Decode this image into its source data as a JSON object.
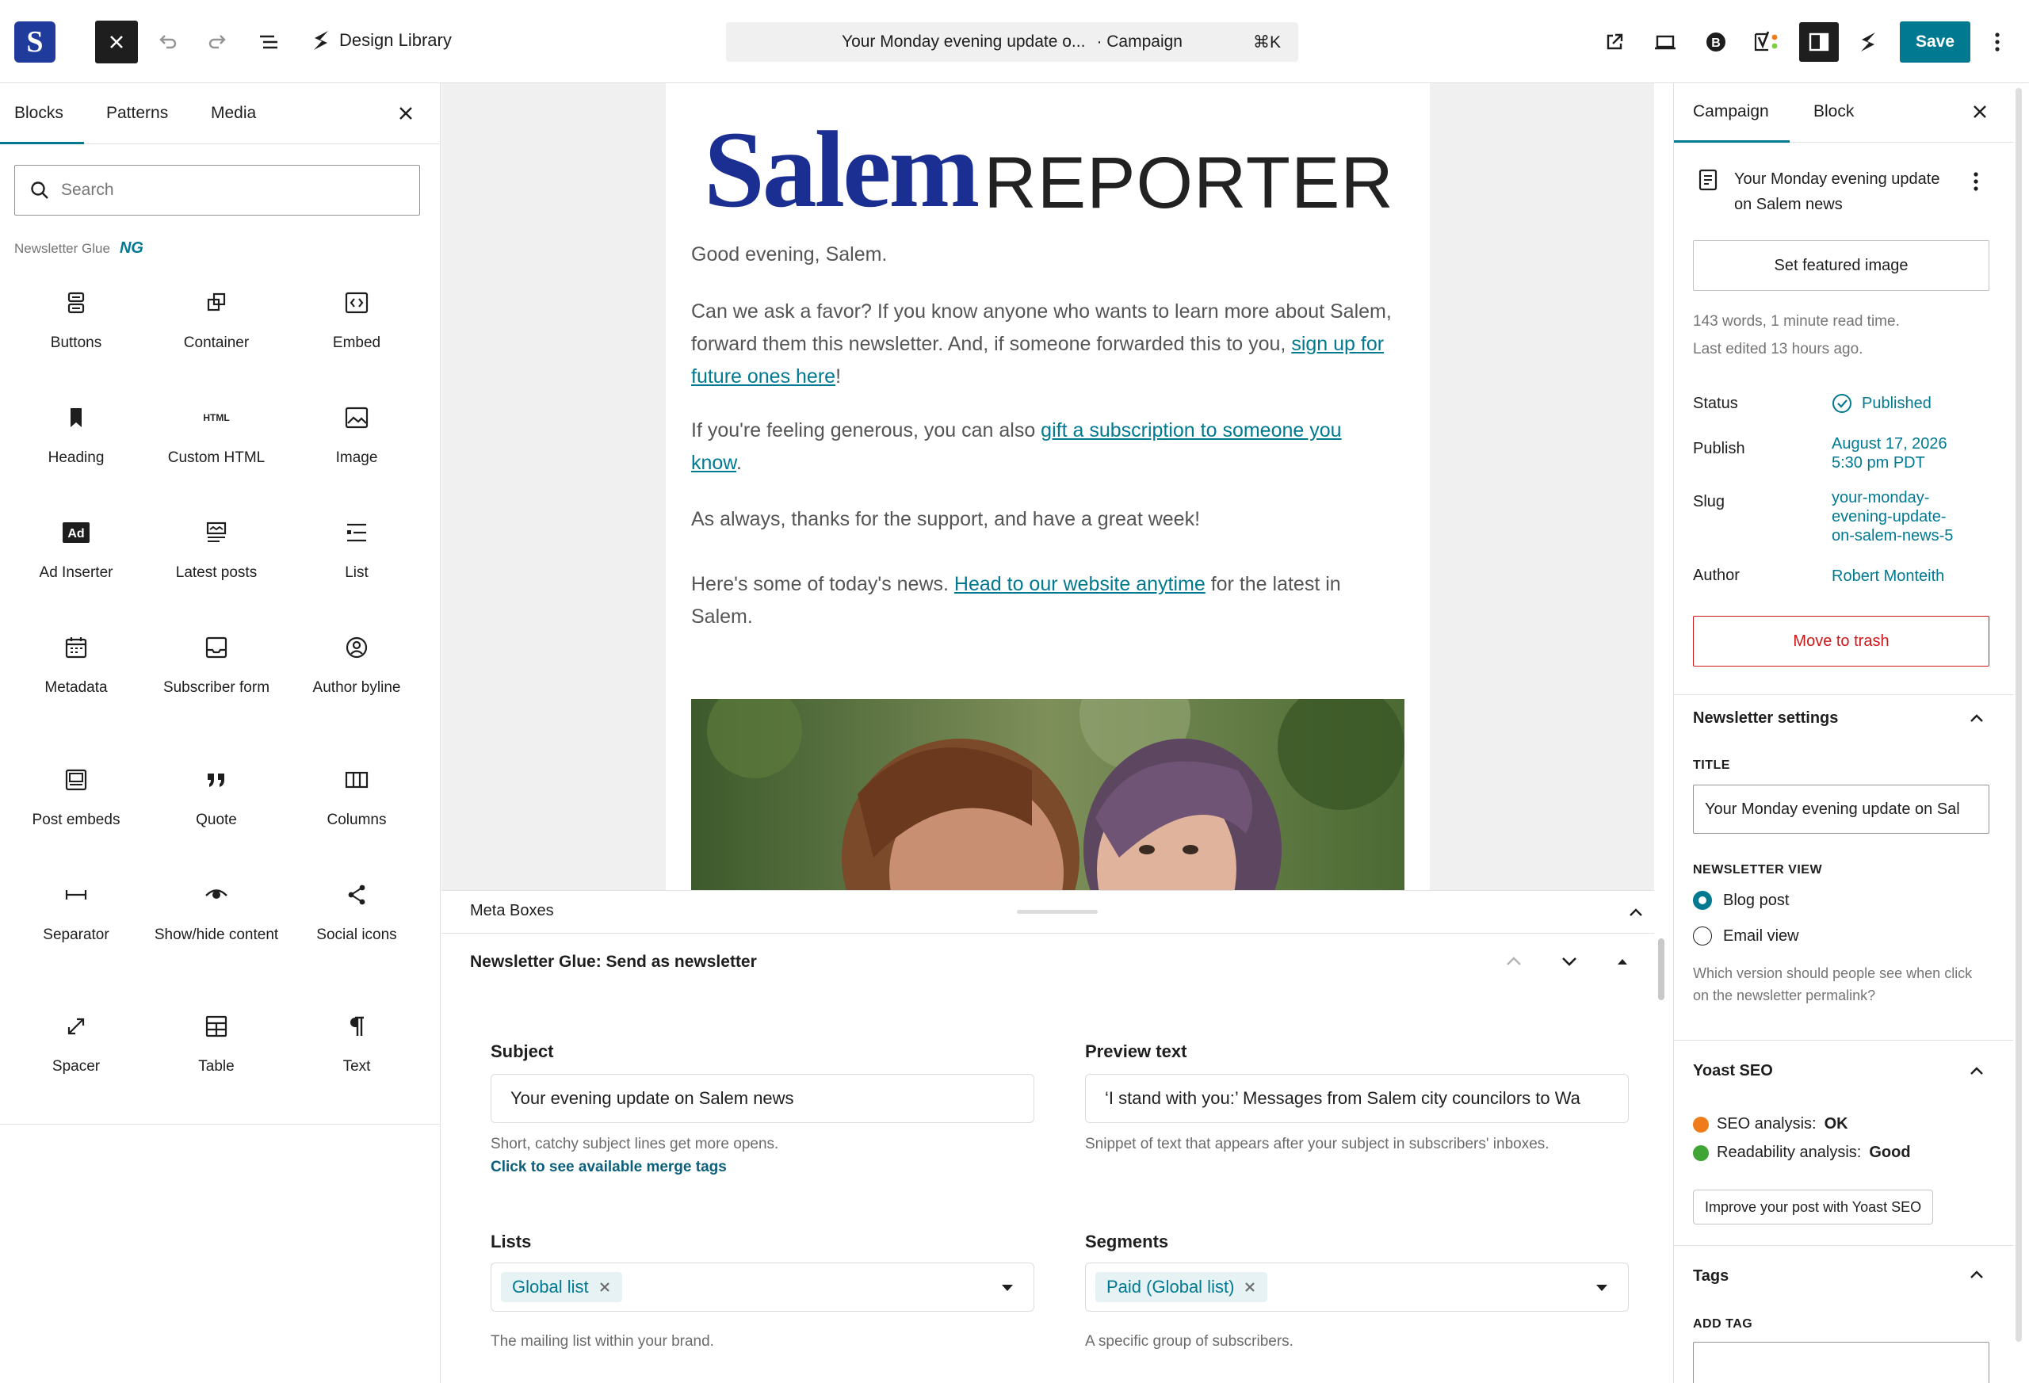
{
  "topbar": {
    "site_logo_letter": "S",
    "library_label": "Design Library",
    "document_title": "Your Monday evening update o...",
    "document_type": "· Campaign",
    "shortcut": "⌘K",
    "save_label": "Save"
  },
  "inserter": {
    "tabs": [
      "Blocks",
      "Patterns",
      "Media"
    ],
    "search_placeholder": "Search",
    "section": "Newsletter Glue",
    "section_badge": "NG",
    "blocks": [
      {
        "label": "Buttons",
        "icon": "buttons-icon"
      },
      {
        "label": "Container",
        "icon": "container-icon"
      },
      {
        "label": "Embed",
        "icon": "embed-icon"
      },
      {
        "label": "Heading",
        "icon": "bookmark-icon"
      },
      {
        "label": "Custom HTML",
        "icon": "html-icon"
      },
      {
        "label": "Image",
        "icon": "image-icon"
      },
      {
        "label": "Ad Inserter",
        "icon": "ad-icon"
      },
      {
        "label": "Latest posts",
        "icon": "latest-posts-icon"
      },
      {
        "label": "List",
        "icon": "list-icon"
      },
      {
        "label": "Metadata",
        "icon": "calendar-icon"
      },
      {
        "label": "Subscriber form",
        "icon": "inbox-icon"
      },
      {
        "label": "Author byline",
        "icon": "user-circle-icon"
      },
      {
        "label": "Post embeds",
        "icon": "post-embed-icon"
      },
      {
        "label": "Quote",
        "icon": "quote-icon"
      },
      {
        "label": "Columns",
        "icon": "columns-icon"
      },
      {
        "label": "Separator",
        "icon": "separator-icon"
      },
      {
        "label": "Show/hide content",
        "icon": "eye-icon"
      },
      {
        "label": "Social icons",
        "icon": "share-icon"
      },
      {
        "label": "Spacer",
        "icon": "resize-icon"
      },
      {
        "label": "Table",
        "icon": "table-icon"
      },
      {
        "label": "Text",
        "icon": "pilcrow-icon"
      }
    ]
  },
  "email": {
    "masthead_a": "Salem",
    "masthead_b": "REPORTER",
    "greeting": "Good evening, Salem.",
    "p1_a": "Can we ask a favor? If you know anyone who wants to learn more about Salem, forward them this newsletter. And, if someone forwarded this to you, ",
    "p1_link": "sign up for future ones here",
    "p1_b": "!",
    "p2_a": "If you're feeling generous, you can also ",
    "p2_link": "gift a subscription to someone you know",
    "p2_b": ".",
    "p3": "As always, thanks for the support, and have a great week!",
    "p4_a": "Here's some of today's news. ",
    "p4_link": "Head to our website anytime",
    "p4_b": " for the latest in Salem."
  },
  "meta": {
    "title": "Meta Boxes",
    "box_title": "Newsletter Glue: Send as newsletter",
    "subject_label": "Subject",
    "subject_value": "Your evening update on Salem news",
    "subject_help": "Short, catchy subject lines get more opens.",
    "merge_tags_link": "Click to see available merge tags",
    "preview_label": "Preview text",
    "preview_value": "‘I stand with you:’ Messages from Salem city councilors to Wa",
    "preview_help": "Snippet of text that appears after your subject in subscribers' inboxes.",
    "lists_label": "Lists",
    "lists_chip": "Global list",
    "lists_help": "The mailing list within your brand.",
    "segments_label": "Segments",
    "segments_chip": "Paid (Global list)",
    "segments_help": "A specific group of subscribers."
  },
  "sidebar": {
    "tabs": [
      "Campaign",
      "Block"
    ],
    "post_title": "Your Monday evening update on Salem news",
    "featured_image_btn": "Set featured image",
    "word_count": "143 words, 1 minute read time.",
    "last_edited": "Last edited 13 hours ago.",
    "status_label": "Status",
    "status_value": "Published",
    "publish_label": "Publish",
    "publish_date": "August 17, 2026",
    "publish_time": "5:30 pm PDT",
    "slug_label": "Slug",
    "slug_line1": "your-monday-",
    "slug_line2": "evening-update-",
    "slug_line3": "on-salem-news-5",
    "author_label": "Author",
    "author_value": "Robert Monteith",
    "trash_btn": "Move to trash",
    "newsletter_settings": "Newsletter settings",
    "title_caps": "TITLE",
    "title_value": "Your Monday evening update on Sal",
    "view_caps": "NEWSLETTER VIEW",
    "view_blog": "Blog post",
    "view_email": "Email view",
    "view_help": "Which version should people see when click on the newsletter permalink?",
    "yoast_title": "Yoast SEO",
    "seo_label": "SEO analysis:",
    "seo_value": "OK",
    "read_label": "Readability analysis:",
    "read_value": "Good",
    "yoast_btn": "Improve your post with Yoast SEO",
    "tags_title": "Tags",
    "add_tag_caps": "ADD TAG"
  },
  "colors": {
    "accent": "#007991",
    "brand_blue": "#1b2f93",
    "danger": "#cc1818",
    "seo_ok": "#ee7c1b",
    "seo_good": "#7ad03a"
  }
}
